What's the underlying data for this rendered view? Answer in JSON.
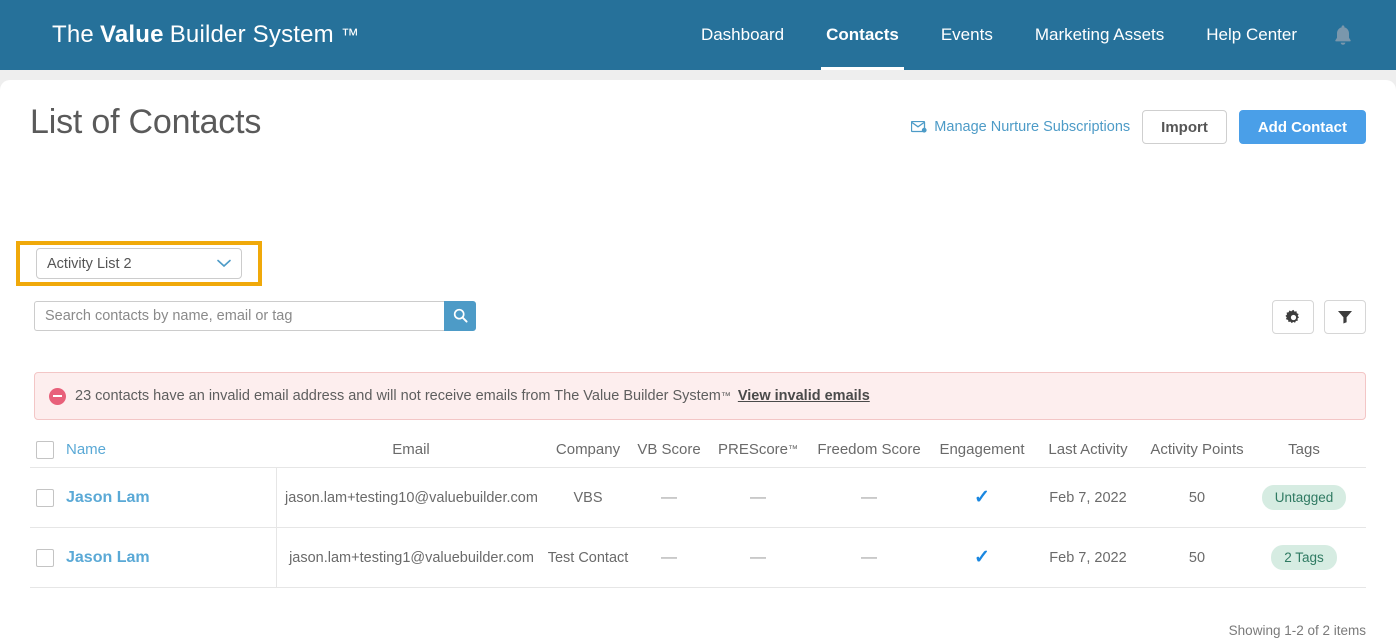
{
  "header": {
    "brand_prefix": "The",
    "brand_bold": "Value",
    "brand_suffix": "Builder System",
    "brand_tm": "™",
    "nav": [
      {
        "label": "Dashboard",
        "active": false
      },
      {
        "label": "Contacts",
        "active": true
      },
      {
        "label": "Events",
        "active": false
      },
      {
        "label": "Marketing Assets",
        "active": false
      },
      {
        "label": "Help Center",
        "active": false
      }
    ],
    "bell_icon": "bell-icon",
    "background_color": "#26719a"
  },
  "page": {
    "title": "List of Contacts",
    "list_selector": {
      "value": "Activity List 2",
      "highlight_color": "#f0a90a"
    },
    "actions": {
      "nurture_link": "Manage Nurture Subscriptions",
      "nurture_icon": "envelope-icon",
      "import_label": "Import",
      "add_contact_label": "Add Contact",
      "primary_color": "#4a9fe8"
    },
    "search": {
      "placeholder": "Search contacts by name, email or tag",
      "value": "",
      "search_icon": "search-icon"
    },
    "toolbar_icons": {
      "settings": "gear-icon",
      "filter": "funnel-icon"
    }
  },
  "alert": {
    "icon": "error-circle-minus-icon",
    "text": "23 contacts have an invalid email address and will not receive emails from The Value Builder System",
    "tm": "™",
    "link": "View invalid emails",
    "background_color": "#fdeeee",
    "border_color": "#f3c6c6"
  },
  "table": {
    "columns": [
      "Name",
      "Email",
      "Company",
      "VB Score",
      "PREScore",
      "Freedom Score",
      "Engagement",
      "Last Activity",
      "Activity Points",
      "Tags"
    ],
    "prescore_tm": "™",
    "rows": [
      {
        "name": "Jason Lam",
        "email": "jason.lam+testing10@valuebuilder.com",
        "company": "VBS",
        "vb_score": "—",
        "prescore": "—",
        "freedom_score": "—",
        "engagement": "✓",
        "last_activity": "Feb 7, 2022",
        "activity_points": "50",
        "tags": "Untagged"
      },
      {
        "name": "Jason Lam",
        "email": "jason.lam+testing1@valuebuilder.com",
        "company": "Test Contact",
        "vb_score": "—",
        "prescore": "—",
        "freedom_score": "—",
        "engagement": "✓",
        "last_activity": "Feb 7, 2022",
        "activity_points": "50",
        "tags": "2 Tags"
      }
    ]
  },
  "footer": {
    "showing": "Showing 1-2 of 2 items"
  }
}
